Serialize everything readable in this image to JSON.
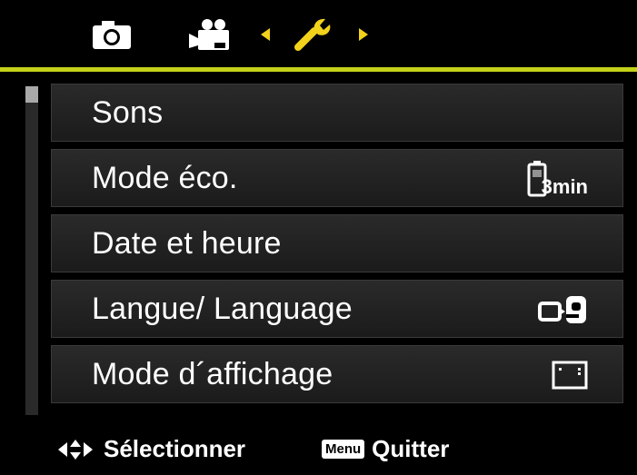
{
  "tabs": {
    "camera_icon": "camera-icon",
    "video_icon": "video-camera-icon",
    "setup_icon": "wrench-icon",
    "active": "setup"
  },
  "colors": {
    "accent": "#c4d21a",
    "active_tab": "#f2d21a",
    "background": "#000000",
    "item_background": "#242424",
    "text": "#ffffff"
  },
  "menu": {
    "items": [
      {
        "label": "Sons",
        "icon": ""
      },
      {
        "label": "Mode éco.",
        "icon": "battery-3min-icon",
        "icon_text": "3min"
      },
      {
        "label": "Date et heure",
        "icon": ""
      },
      {
        "label": "Langue/ Language",
        "icon": "language-icon"
      },
      {
        "label": "Mode d´affichage",
        "icon": "display-mode-icon"
      }
    ]
  },
  "footer": {
    "nav_label": "Sélectionner",
    "menu_key": "Menu",
    "menu_label": "Quitter"
  }
}
